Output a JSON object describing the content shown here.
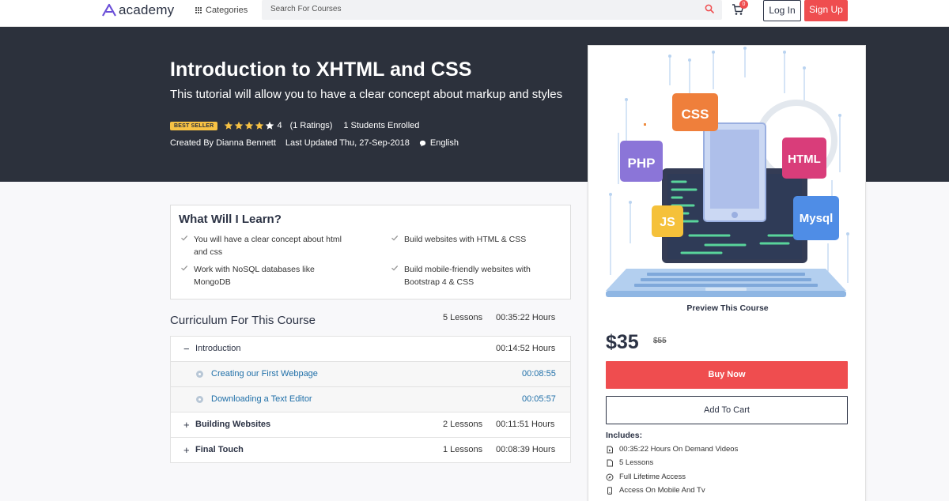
{
  "nav": {
    "logo_text": "academy",
    "categories_label": "Categories",
    "search_placeholder": "Search For Courses",
    "cart_count": "0",
    "login_label": "Log In",
    "signup_label": "Sign Up"
  },
  "hero": {
    "title": "Introduction to XHTML and CSS",
    "subtitle": "This tutorial will allow you to have a clear concept about markup and styles",
    "badge": "BEST SELLER",
    "rating_value": "4",
    "rating_stars": 4,
    "ratings_count": "(1 Ratings)",
    "students": "1 Students Enrolled",
    "author": "Created By Dianna Bennett",
    "updated": "Last Updated Thu, 27-Sep-2018",
    "language": "English"
  },
  "learn": {
    "title": "What Will I Learn?",
    "items": [
      "You will have a clear concept about html and css",
      "Build websites with HTML & CSS",
      "Work with NoSQL databases like MongoDB",
      "Build mobile-friendly websites with Bootstrap 4 & CSS"
    ]
  },
  "curriculum": {
    "title": "Curriculum For This Course",
    "total_lessons": "5 Lessons",
    "total_time": "00:35:22 Hours",
    "sections": [
      {
        "sign": "−",
        "label": "Introduction",
        "count": "",
        "time": "00:14:52 Hours"
      },
      {
        "label": "Creating our First Webpage",
        "time": "00:08:55"
      },
      {
        "label": "Downloading a Text Editor",
        "time": "00:05:57"
      },
      {
        "sign": "+",
        "label": "Building Websites",
        "count": "2 Lessons",
        "time": "00:11:51 Hours"
      },
      {
        "sign": "+",
        "label": "Final Touch",
        "count": "1 Lessons",
        "time": "00:08:39 Hours"
      }
    ]
  },
  "card": {
    "illustration_tags": [
      "CSS",
      "PHP",
      "HTML",
      "JS",
      "Mysql"
    ],
    "preview_label": "Preview This Course",
    "price": "$35",
    "old_price": "$55",
    "buy_label": "Buy Now",
    "add_cart_label": "Add To Cart",
    "includes_title": "Includes:",
    "includes": [
      {
        "icon": "video-file-icon",
        "text": "00:35:22 Hours On Demand Videos"
      },
      {
        "icon": "file-icon",
        "text": "5 Lessons"
      },
      {
        "icon": "compass-icon",
        "text": "Full Lifetime Access"
      },
      {
        "icon": "mobile-icon",
        "text": "Access On Mobile And Tv"
      }
    ]
  },
  "colors": {
    "accent_red": "#ef4d4f",
    "hero_bg": "#2c313c",
    "badge_yellow": "#f7c244",
    "link_blue": "#1f6fa8"
  }
}
